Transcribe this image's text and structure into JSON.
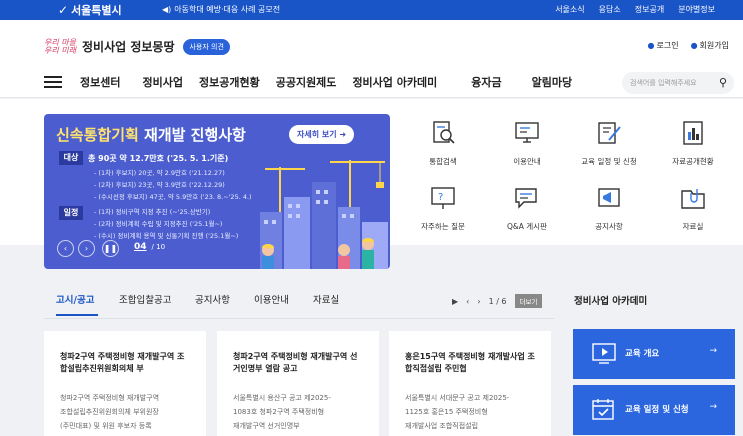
{
  "topbar": {
    "site_name": "서울특별시",
    "notice": "아동학대 예방·대응 사례 공모전",
    "links": [
      "서울소식",
      "응답소",
      "정보공개",
      "분야별정보"
    ]
  },
  "header": {
    "script_logo_line1": "우리 마을",
    "script_logo_line2": "우리 미래",
    "site_title": "정비사업 정보몽땅",
    "feedback_label": "사용자 의견",
    "login_label": "로그인",
    "signup_label": "회원가입"
  },
  "nav": {
    "items": [
      "정보센터",
      "정비사업",
      "정보공개현황",
      "공공지원제도",
      "정비사업 아카데미",
      "융자금",
      "알림마당"
    ],
    "search_placeholder": "검색어를 입력해주세요"
  },
  "banner": {
    "title_highlight": "신속통합기획",
    "title_rest": " 재개발 진행사항",
    "more_label": "자세히 보기",
    "target_tag": "대상",
    "target_head": "총 90곳 약 12.7만호 ('25. 5. 1.기준)",
    "target_lines": [
      "- (1차) 후보지) 20곳, 약 2.9만호 ('21.12.27)",
      "- (2차) 후보지) 23곳, 약 3.9만호 ('22.12.29)",
      "- (수시선정 후보지) 47곳, 약 5.9만호 ('23. 8.~'25. 4.)"
    ],
    "schedule_tag": "일정",
    "schedule_lines": [
      "- (1차) 정비구역 지정 추진 (~'25.상반기)",
      "- (2차) 정비계획 수립 및 지정추진 ('25.1월~)",
      "- (수시) 정비계획 용역 및 신통기획 진행 ('25.1월~)"
    ],
    "page_current": "04",
    "page_total": "/ 10"
  },
  "quick_links": [
    {
      "label": "통합검색",
      "icon": "search-doc-icon"
    },
    {
      "label": "이용안내",
      "icon": "computer-guide-icon"
    },
    {
      "label": "교육 일정 및 신청",
      "icon": "edit-doc-icon"
    },
    {
      "label": "자료공개현황",
      "icon": "bar-chart-doc-icon"
    },
    {
      "label": "자주하는 질문",
      "icon": "faq-board-icon"
    },
    {
      "label": "Q&A 게시판",
      "icon": "chat-bubble-icon"
    },
    {
      "label": "공지사항",
      "icon": "megaphone-icon"
    },
    {
      "label": "자료실",
      "icon": "folder-clip-icon"
    }
  ],
  "notices": {
    "tabs": [
      "고시/공고",
      "조합입찰공고",
      "공지사항",
      "이용안내",
      "자료실"
    ],
    "active_tab": 0,
    "page_indicator": "1 / 6",
    "more_label": "더보기",
    "cards": [
      {
        "title": "청파2구역 주택정비형 재개발구역 조합설립추진위원회의체 부",
        "body": [
          "청파2구역 주택정비형 재개발구역",
          "조합설립추진위원회의체 부위원장",
          "(주민대표) 및 위원 후보자 등록"
        ]
      },
      {
        "title": "청파2구역 주택정비형 재개발구역 선거인명부 열람 공고",
        "body": [
          "서울특별시 용산구 공고 제2025-",
          "1083호 청파2구역 주택정비형",
          "재개발구역 선거인명부"
        ]
      },
      {
        "title": "홍은15구역 주택정비형 재개발사업 조합직접설립 주민협",
        "body": [
          "서울특별시 서대문구 공고 제2025-",
          "1125호 홍은15 주택정비형",
          "재개발사업 조합직접설립"
        ]
      }
    ]
  },
  "academy": {
    "title": "정비사업 아카데미",
    "items": [
      {
        "label": "교육 개요",
        "icon": "video-play-icon"
      },
      {
        "label": "교육 일정 및 신청",
        "icon": "calendar-check-icon"
      }
    ]
  },
  "colors": {
    "primary": "#1a55c7",
    "banner": "#4c5ecf",
    "academy": "#2b66df",
    "highlight": "#ffe36b"
  }
}
